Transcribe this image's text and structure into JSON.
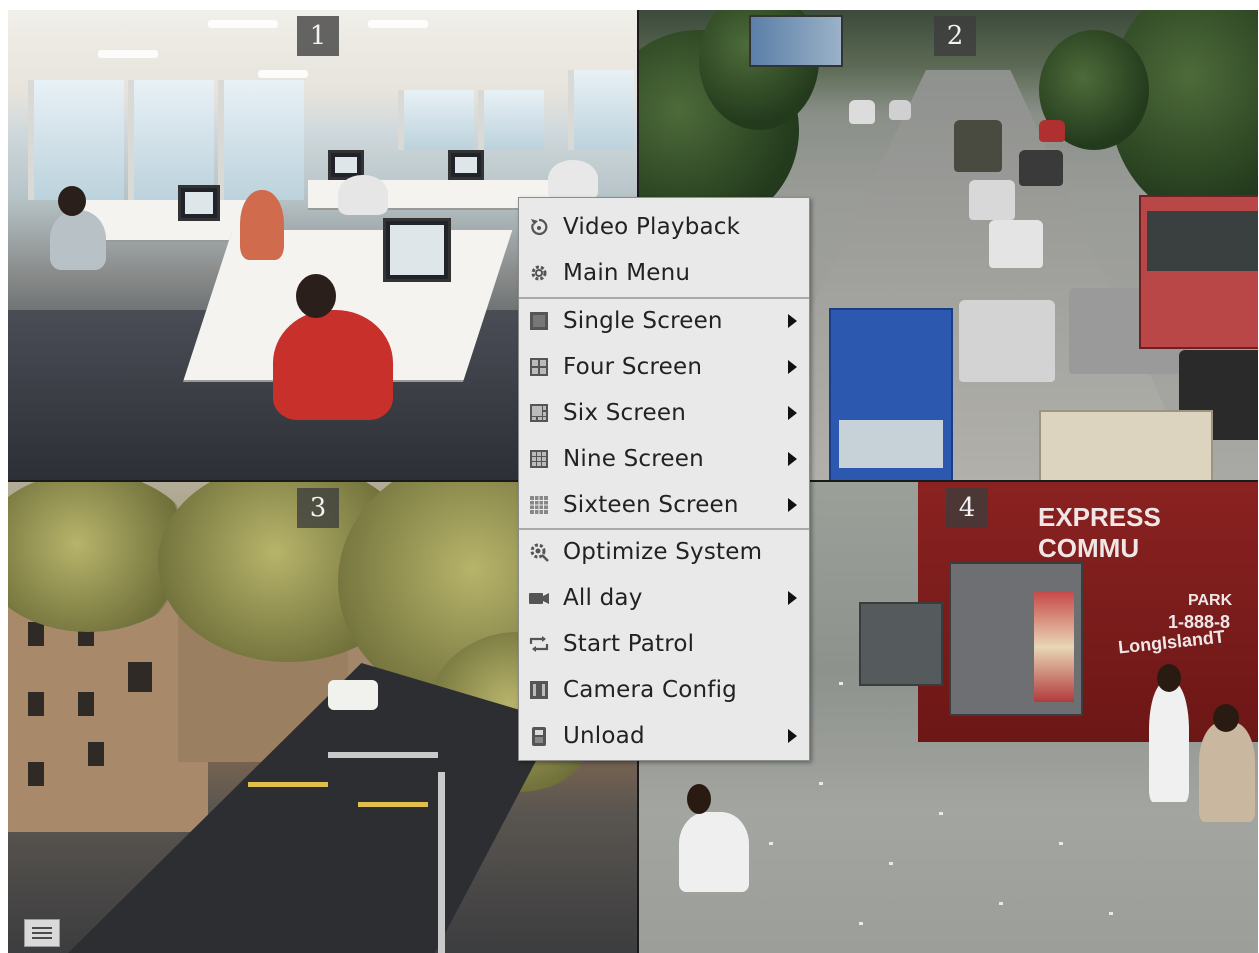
{
  "panes": [
    {
      "number": "1",
      "scene": "office"
    },
    {
      "number": "2",
      "scene": "street-traffic"
    },
    {
      "number": "3",
      "scene": "city-street-trees"
    },
    {
      "number": "4",
      "scene": "sidewalk-bus-stop"
    }
  ],
  "scene4_bus_text": {
    "line1": "EXPRESS COMMU",
    "line2": "PARK",
    "line3": "1-888-8",
    "line4": "LongIslandT"
  },
  "context_menu": {
    "items": [
      {
        "label": "Video Playback",
        "icon": "playback-icon",
        "submenu": false
      },
      {
        "label": "Main Menu",
        "icon": "gear-icon",
        "submenu": false
      },
      {
        "label": "Single Screen",
        "icon": "single-screen-icon",
        "submenu": true
      },
      {
        "label": "Four Screen",
        "icon": "four-screen-icon",
        "submenu": true
      },
      {
        "label": "Six Screen",
        "icon": "six-screen-icon",
        "submenu": true
      },
      {
        "label": "Nine Screen",
        "icon": "nine-screen-icon",
        "submenu": true
      },
      {
        "label": "Sixteen Screen",
        "icon": "sixteen-screen-icon",
        "submenu": true
      },
      {
        "label": "Optimize System",
        "icon": "optimize-icon",
        "submenu": false
      },
      {
        "label": "All day",
        "icon": "camera-icon",
        "submenu": true
      },
      {
        "label": "Start Patrol",
        "icon": "patrol-icon",
        "submenu": false
      },
      {
        "label": "Camera Config",
        "icon": "camera-config-icon",
        "submenu": false
      },
      {
        "label": "Unload",
        "icon": "unload-icon",
        "submenu": true
      }
    ]
  },
  "colors": {
    "menu_bg": "#e9e9e9",
    "menu_text": "#222222",
    "pane_number_bg": "#3c3c3c"
  }
}
